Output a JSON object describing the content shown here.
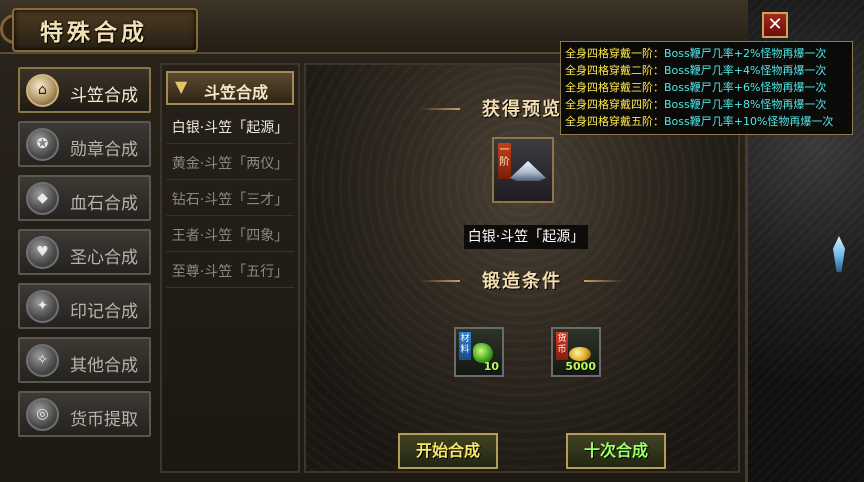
{
  "window": {
    "title": "特殊合成",
    "close_label": "✕"
  },
  "categories": [
    {
      "label": "斗笠合成",
      "icon": "hat-icon",
      "glyph": "⌂",
      "active": true
    },
    {
      "label": "勋章合成",
      "icon": "medal-icon",
      "glyph": "✪",
      "active": false
    },
    {
      "label": "血石合成",
      "icon": "bloodstone-icon",
      "glyph": "◆",
      "active": false
    },
    {
      "label": "圣心合成",
      "icon": "holy-heart-icon",
      "glyph": "♥",
      "active": false
    },
    {
      "label": "印记合成",
      "icon": "mark-icon",
      "glyph": "✦",
      "active": false
    },
    {
      "label": "其他合成",
      "icon": "other-icon",
      "glyph": "✧",
      "active": false
    },
    {
      "label": "货币提取",
      "icon": "currency-icon",
      "glyph": "◎",
      "active": false
    }
  ],
  "subcategory": {
    "header": "斗笠合成",
    "items": [
      {
        "label": "白银·斗笠「起源」",
        "selected": true
      },
      {
        "label": "黄金·斗笠「两仪」",
        "selected": false
      },
      {
        "label": "钻石·斗笠「三才」",
        "selected": false
      },
      {
        "label": "王者·斗笠「四象」",
        "selected": false
      },
      {
        "label": "至尊·斗笠「五行」",
        "selected": false
      }
    ]
  },
  "preview": {
    "obtain_banner": "获得预览",
    "item_name": "白银·斗笠「起源」",
    "item_tier": "一阶",
    "conditions_banner": "锻造条件",
    "costs": [
      {
        "tag": "材料",
        "qty": "10",
        "icon": "material-gem-icon"
      },
      {
        "tag": "货币",
        "qty": "5000",
        "icon": "gold-ingot-icon"
      }
    ],
    "start_button": "开始合成",
    "ten_button": "十次合成"
  },
  "tooltip": {
    "lines": [
      {
        "prefix": "全身四格穿戴一阶：",
        "suffix": "Boss鞭尸几率+2%怪物再爆一次"
      },
      {
        "prefix": "全身四格穿戴二阶：",
        "suffix": "Boss鞭尸几率+4%怪物再爆一次"
      },
      {
        "prefix": "全身四格穿戴三阶：",
        "suffix": "Boss鞭尸几率+6%怪物再爆一次"
      },
      {
        "prefix": "全身四格穿戴四阶：",
        "suffix": "Boss鞭尸几率+8%怪物再爆一次"
      },
      {
        "prefix": "全身四格穿戴五阶：",
        "suffix": "Boss鞭尸几率+10%怪物再爆一次"
      }
    ]
  },
  "colors": {
    "accent_gold": "#c9a15a",
    "tooltip_prefix": "#ffe84a",
    "tooltip_suffix": "#4fe9e9",
    "button_text": "#f7e66a",
    "ten_button_text": "#9dff6a"
  }
}
